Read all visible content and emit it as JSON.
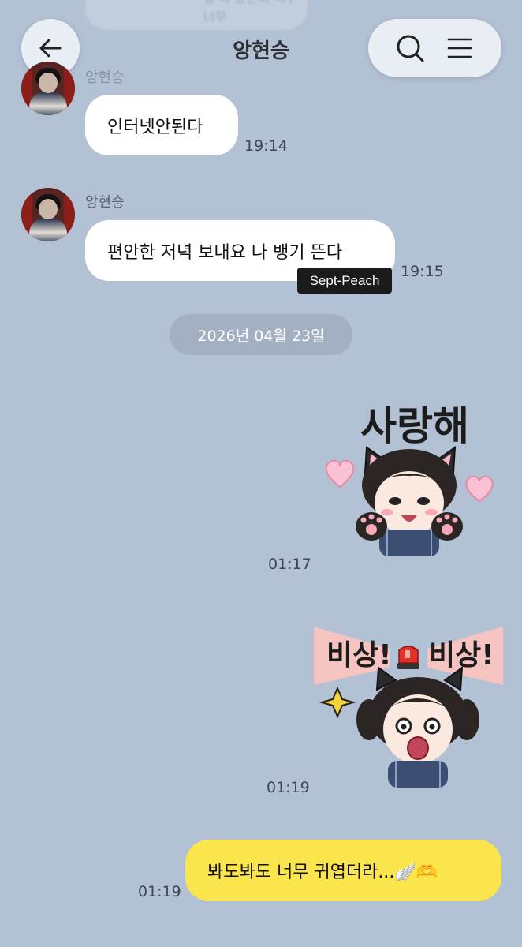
{
  "header": {
    "title": "앙현승",
    "back_icon": "arrow-left-icon",
    "search_icon": "search-icon",
    "menu_icon": "hamburger-menu-icon"
  },
  "ghost_bubble_text": "를 다 봤는데 너무너무",
  "messages": [
    {
      "sender": "앙현승",
      "text": "인터넷안된다",
      "time": "19:14"
    },
    {
      "sender": "앙현승",
      "text": "편안한 저녁 보내요 나 뱅기 뜬다",
      "time": "19:15"
    }
  ],
  "watermark": "Sept-Peach",
  "date_divider": "2026년 04월 23일",
  "stickers": [
    {
      "caption": "사랑해",
      "time": "01:17"
    },
    {
      "caption_left": "비상!",
      "caption_right": "비상!",
      "time": "01:19"
    }
  ],
  "my_message": {
    "text": "봐도봐도 너무 귀엽더라...🪽🫶",
    "time": "01:19"
  },
  "colors": {
    "background": "#b2c1d4",
    "my_bubble": "#fbe54d",
    "their_bubble": "#ffffff",
    "date_chip": "#a2b0c2"
  }
}
